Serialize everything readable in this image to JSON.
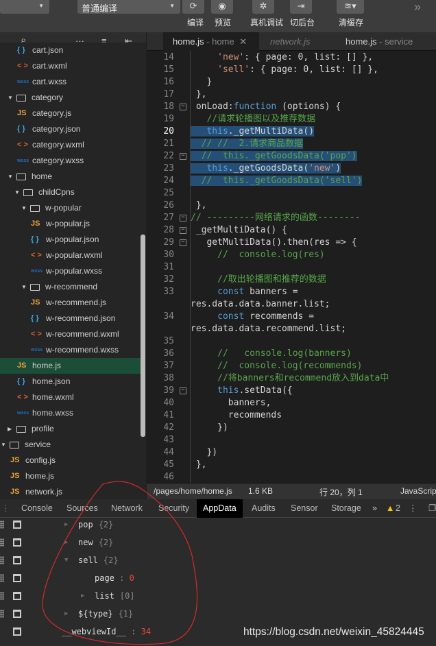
{
  "toolbar": {
    "compile_mode": "普通编译",
    "buttons": [
      {
        "label": "编译",
        "icon": "refresh-icon"
      },
      {
        "label": "预览",
        "icon": "eye-icon"
      },
      {
        "label": "真机调试",
        "icon": "bug-icon"
      },
      {
        "label": "切后台",
        "icon": "background-switch-icon"
      },
      {
        "label": "清缓存",
        "icon": "layers-icon"
      }
    ],
    "more": "»"
  },
  "sidebar_header": {
    "search": "⌕",
    "more": "···",
    "collapse": "≡",
    "split": "⇤"
  },
  "tree": [
    {
      "name": "cart.json",
      "type": "json"
    },
    {
      "name": "cart.wxml",
      "type": "wxml"
    },
    {
      "name": "cart.wxss",
      "type": "wxss"
    },
    {
      "name": "category",
      "type": "folder",
      "open": true
    },
    {
      "name": "category.js",
      "type": "js"
    },
    {
      "name": "category.json",
      "type": "json"
    },
    {
      "name": "category.wxml",
      "type": "wxml"
    },
    {
      "name": "category.wxss",
      "type": "wxss"
    },
    {
      "name": "home",
      "type": "folder",
      "open": true
    },
    {
      "name": "childCpns",
      "type": "folder",
      "open": true
    },
    {
      "name": "w-popular",
      "type": "folder",
      "open": true
    },
    {
      "name": "w-popular.js",
      "type": "js"
    },
    {
      "name": "w-popular.json",
      "type": "json"
    },
    {
      "name": "w-popular.wxml",
      "type": "wxml"
    },
    {
      "name": "w-popular.wxss",
      "type": "wxss"
    },
    {
      "name": "w-recommend",
      "type": "folder",
      "open": true
    },
    {
      "name": "w-recommend.js",
      "type": "js"
    },
    {
      "name": "w-recommend.json",
      "type": "json"
    },
    {
      "name": "w-recommend.wxml",
      "type": "wxml"
    },
    {
      "name": "w-recommend.wxss",
      "type": "wxss"
    },
    {
      "name": "home.js",
      "type": "js",
      "selected": true
    },
    {
      "name": "home.json",
      "type": "json"
    },
    {
      "name": "home.wxml",
      "type": "wxml"
    },
    {
      "name": "home.wxss",
      "type": "wxss"
    },
    {
      "name": "profile",
      "type": "folder",
      "open": false
    },
    {
      "name": "service",
      "type": "folder",
      "open": true
    },
    {
      "name": "config.js",
      "type": "js"
    },
    {
      "name": "home.js",
      "type": "js"
    },
    {
      "name": "network.js",
      "type": "js"
    }
  ],
  "icons": {
    "js": "JS",
    "json": "{ }",
    "wxml": "< >",
    "wxss": "wxss"
  },
  "editor_tabs": [
    {
      "file": "home.js",
      "sub": " - home",
      "active": true,
      "close": "✕"
    },
    {
      "file": "network.js",
      "sub": "",
      "preview": true
    },
    {
      "file": "home.js",
      "sub": " - service"
    }
  ],
  "code": [
    {
      "n": "14",
      "t": [
        [
          "",
          "     "
        ],
        [
          "str",
          "'new'"
        ],
        [
          "",
          ": { page: 0, list: [] },"
        ]
      ]
    },
    {
      "n": "15",
      "t": [
        [
          "",
          "     "
        ],
        [
          "str",
          "'sell'"
        ],
        [
          "",
          ": { page: 0, list: [] },"
        ]
      ]
    },
    {
      "n": "16",
      "t": [
        [
          "",
          "   }"
        ]
      ]
    },
    {
      "n": "17",
      "t": [
        [
          "",
          " },"
        ]
      ]
    },
    {
      "n": "18",
      "fold": true,
      "t": [
        [
          "",
          " onLoad:"
        ],
        [
          "kw",
          "function"
        ],
        [
          "",
          " (options) {"
        ]
      ]
    },
    {
      "n": "19",
      "t": [
        [
          "",
          "   "
        ],
        [
          "cm",
          "//请求轮播图以及推荐数据"
        ]
      ]
    },
    {
      "n": "20",
      "cur": true,
      "sel": true,
      "t": [
        [
          "",
          "   "
        ],
        [
          "kw",
          "this"
        ],
        [
          "",
          "._getMultiData()"
        ]
      ]
    },
    {
      "n": "21",
      "sel": true,
      "t": [
        [
          "",
          "  "
        ],
        [
          "cm",
          "// //  2.请求商品数据"
        ]
      ]
    },
    {
      "n": "22",
      "fold": true,
      "sel": true,
      "t": [
        [
          "",
          "  "
        ],
        [
          "cm",
          "//  this._getGoodsData('pop')"
        ]
      ]
    },
    {
      "n": "23",
      "sel": true,
      "t": [
        [
          "",
          "   "
        ],
        [
          "kw",
          "this"
        ],
        [
          "",
          "._getGoodsData("
        ],
        [
          "str",
          "'new'"
        ],
        [
          "",
          ")"
        ]
      ]
    },
    {
      "n": "24",
      "sel": true,
      "t": [
        [
          "",
          "  "
        ],
        [
          "cm",
          "//  this._getGoodsData('sell')"
        ]
      ]
    },
    {
      "n": "25",
      "t": []
    },
    {
      "n": "26",
      "t": [
        [
          "",
          " },"
        ]
      ]
    },
    {
      "n": "27",
      "fold": true,
      "t": [
        [
          "cm",
          "// ---------网络请求的函数--------"
        ]
      ]
    },
    {
      "n": "28",
      "fold": true,
      "t": [
        [
          "",
          " _getMultiData() {"
        ]
      ]
    },
    {
      "n": "29",
      "fold": true,
      "t": [
        [
          "",
          "   getMultiData().then(res => {"
        ]
      ]
    },
    {
      "n": "30",
      "t": [
        [
          "",
          "     "
        ],
        [
          "cm",
          "//  console.log(res)"
        ]
      ]
    },
    {
      "n": "31",
      "t": []
    },
    {
      "n": "32",
      "t": [
        [
          "",
          "     "
        ],
        [
          "cm",
          "//取出轮播图和推荐的数据"
        ]
      ]
    },
    {
      "n": "33",
      "t": [
        [
          "",
          "     "
        ],
        [
          "kw",
          "const"
        ],
        [
          "",
          " banners ="
        ]
      ]
    },
    {
      "n": "",
      "t": [
        [
          "",
          "res.data.data.banner.list;"
        ]
      ]
    },
    {
      "n": "34",
      "t": [
        [
          "",
          "     "
        ],
        [
          "kw",
          "const"
        ],
        [
          "",
          " recommends ="
        ]
      ]
    },
    {
      "n": "",
      "t": [
        [
          "",
          "res.data.data.recommend.list;"
        ]
      ]
    },
    {
      "n": "35",
      "t": []
    },
    {
      "n": "36",
      "t": [
        [
          "",
          "     "
        ],
        [
          "cm",
          "//   console.log(banners)"
        ]
      ]
    },
    {
      "n": "37",
      "t": [
        [
          "",
          "     "
        ],
        [
          "cm",
          "//  console.log(recommends)"
        ]
      ]
    },
    {
      "n": "38",
      "t": [
        [
          "",
          "     "
        ],
        [
          "cm",
          "//将banners和recommend放入到data中"
        ]
      ]
    },
    {
      "n": "39",
      "fold": true,
      "t": [
        [
          "",
          "     "
        ],
        [
          "kw",
          "this"
        ],
        [
          "",
          ".setData({"
        ]
      ]
    },
    {
      "n": "40",
      "t": [
        [
          "",
          "       banners,"
        ]
      ]
    },
    {
      "n": "41",
      "t": [
        [
          "",
          "       recommends"
        ]
      ]
    },
    {
      "n": "42",
      "t": [
        [
          "",
          "     })"
        ]
      ]
    },
    {
      "n": "43",
      "t": []
    },
    {
      "n": "44",
      "t": [
        [
          "",
          "   })"
        ]
      ]
    },
    {
      "n": "45",
      "t": [
        [
          "",
          " },"
        ]
      ]
    },
    {
      "n": "46",
      "t": []
    }
  ],
  "status": {
    "path": "/pages/home/home.js",
    "size": "1.6 KB",
    "cursor": "行 20，列 1",
    "language": "JavaScript"
  },
  "devtools_tabs": [
    "Console",
    "Sources",
    "Network",
    "Security",
    "AppData",
    "Audits",
    "Sensor",
    "Storage"
  ],
  "devtools_active": "AppData",
  "devtools_more": "»",
  "warnings": "2",
  "appdata": [
    {
      "key": "pop",
      "meta": "{2}",
      "arrow": "right",
      "level": 1
    },
    {
      "key": "new",
      "meta": "{2}",
      "arrow": "right",
      "level": 1
    },
    {
      "key": "sell",
      "meta": "{2}",
      "arrow": "down",
      "level": 1
    },
    {
      "key": "page",
      "value": "0",
      "level": 2
    },
    {
      "key": "list",
      "meta": "[0]",
      "arrow": "right",
      "level": 2
    },
    {
      "key": "${type}",
      "meta": "{1}",
      "arrow": "right",
      "level": 1
    },
    {
      "key": "__webviewId__",
      "value": "34",
      "level": 0
    }
  ],
  "watermark": "https://blog.csdn.net/weixin_45824445",
  "colors": {
    "selection": "#264f78",
    "selected_file": "#1b4d38",
    "annotation": "#d42a2a"
  }
}
